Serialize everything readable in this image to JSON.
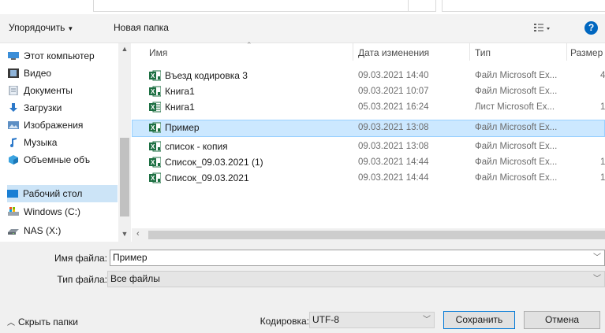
{
  "toolbar": {
    "organize_label": "Упорядочить",
    "new_folder_label": "Новая папка",
    "help_label": "?"
  },
  "nav": {
    "items": [
      {
        "label": "Этот компьютер",
        "icon": "computer-icon"
      },
      {
        "label": "Видео",
        "icon": "video-icon"
      },
      {
        "label": "Документы",
        "icon": "documents-icon"
      },
      {
        "label": "Загрузки",
        "icon": "downloads-icon"
      },
      {
        "label": "Изображения",
        "icon": "images-icon"
      },
      {
        "label": "Музыка",
        "icon": "music-icon"
      },
      {
        "label": "Объемные объ",
        "icon": "3d-objects-icon"
      },
      {
        "label": "Рабочий стол",
        "icon": "desktop-icon",
        "selected": true
      },
      {
        "label": "Windows (C:)",
        "icon": "drive-icon"
      },
      {
        "label": "NAS (X:)",
        "icon": "network-drive-icon"
      }
    ]
  },
  "list": {
    "columns": [
      "Имя",
      "Дата изменения",
      "Тип",
      "Размер"
    ],
    "rows": [
      {
        "name": "Въезд кодировка 3",
        "date": "09.03.2021 14:40",
        "type": "Файл Microsoft Ex...",
        "size": "4",
        "icon": "excel-csv-icon"
      },
      {
        "name": "Книга1",
        "date": "09.03.2021 10:07",
        "type": "Файл Microsoft Ex...",
        "size": "",
        "icon": "excel-csv-icon"
      },
      {
        "name": "Книга1",
        "date": "05.03.2021 16:24",
        "type": "Лист Microsoft Ex...",
        "size": "1",
        "icon": "excel-sheet-icon"
      },
      {
        "name": "Пример",
        "date": "09.03.2021 13:08",
        "type": "Файл Microsoft Ex...",
        "size": "",
        "icon": "excel-csv-icon",
        "selected": true
      },
      {
        "name": "список - копия",
        "date": "09.03.2021 13:08",
        "type": "Файл Microsoft Ex...",
        "size": "",
        "icon": "excel-csv-icon"
      },
      {
        "name": "Список_09.03.2021 (1)",
        "date": "09.03.2021 14:44",
        "type": "Файл Microsoft Ex...",
        "size": "1",
        "icon": "excel-csv-icon"
      },
      {
        "name": "Список_09.03.2021",
        "date": "09.03.2021 14:44",
        "type": "Файл Microsoft Ex...",
        "size": "1",
        "icon": "excel-csv-icon"
      }
    ]
  },
  "form": {
    "filename_label": "Имя файла:",
    "filename_value": "Пример",
    "filetype_label": "Тип файла:",
    "filetype_value": "Все файлы",
    "hide_folders_label": "Скрыть папки",
    "encoding_label": "Кодировка:",
    "encoding_value": "UTF-8",
    "save_label": "Сохранить",
    "cancel_label": "Отмена"
  },
  "colors": {
    "accent": "#0067c0",
    "selection": "#cce8ff",
    "excel_green": "#1d6f42"
  }
}
